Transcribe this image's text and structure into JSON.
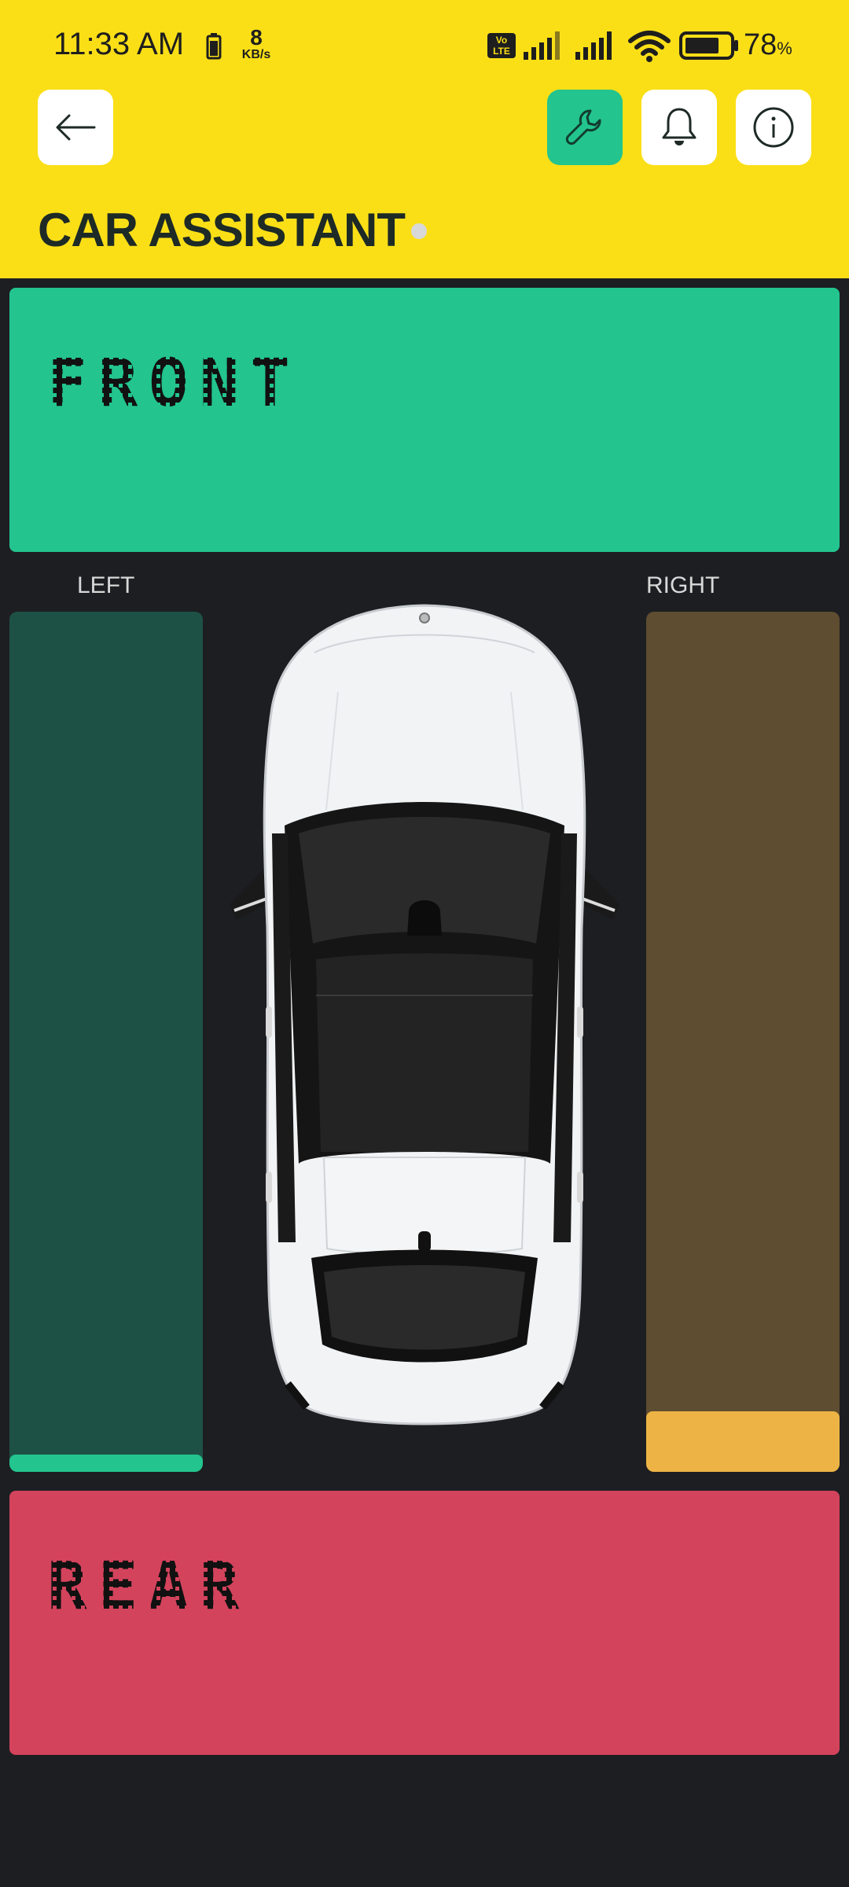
{
  "status_bar": {
    "time": "11:33 AM",
    "net_speed_value": "8",
    "net_speed_unit": "KB/s",
    "volte": "Vo LTE",
    "battery_percent": "78",
    "battery_percent_sign": "%",
    "battery_level": 0.78
  },
  "header": {
    "title": "CAR ASSISTANT",
    "back_icon": "arrow-left-icon",
    "wrench_icon": "wrench-icon",
    "bell_icon": "bell-icon",
    "info_icon": "info-icon",
    "accent_color": "#23c48e",
    "background_color": "#fadf17"
  },
  "front": {
    "label": "FRONT",
    "color": "#23c48e"
  },
  "rear": {
    "label": "REAR",
    "color": "#d3435c"
  },
  "left": {
    "label": "LEFT",
    "level": 0.02,
    "track_color": "#1e5145",
    "fill_color": "#23c48e"
  },
  "right": {
    "label": "RIGHT",
    "level": 0.07,
    "track_color": "#5e4d30",
    "fill_color": "#edb445"
  },
  "car": {
    "icon": "car-top-view-icon"
  }
}
